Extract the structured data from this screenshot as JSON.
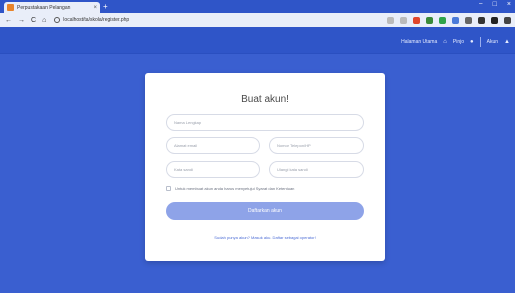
{
  "browser": {
    "tab_title": "Perpustakaan Pelangan",
    "tab_close": "×",
    "new_tab": "+",
    "window_controls": [
      "−",
      "□",
      "×"
    ],
    "nav": [
      "←",
      "→",
      "C",
      "⌂"
    ],
    "url": "localhost/ta/skola/register.php"
  },
  "navbar": {
    "link1": "Halaman Utama",
    "link2": "Pinjo",
    "link3": "Akun"
  },
  "form": {
    "title": "Buat akun!",
    "placeholders": {
      "full_name": "Nama Lengkap",
      "email": "Alamat email",
      "phone": "Nomor Telepon/HP",
      "password": "Kata sandi",
      "password_confirm": "Ulangi kata sandi"
    },
    "checkbox_label": "Untuk membuat akun anda harus menyetujui Syarat dan Ketentuan",
    "submit_label": "Daftarkan akun",
    "footer_link": "Sudah punya akun? Masuk aku. Daftar sebagai operator!"
  },
  "colors": {
    "background": "#3a5fd0",
    "navbar": "#2f55c8",
    "button": "#8ea3e8",
    "link": "#4f6fd6"
  }
}
